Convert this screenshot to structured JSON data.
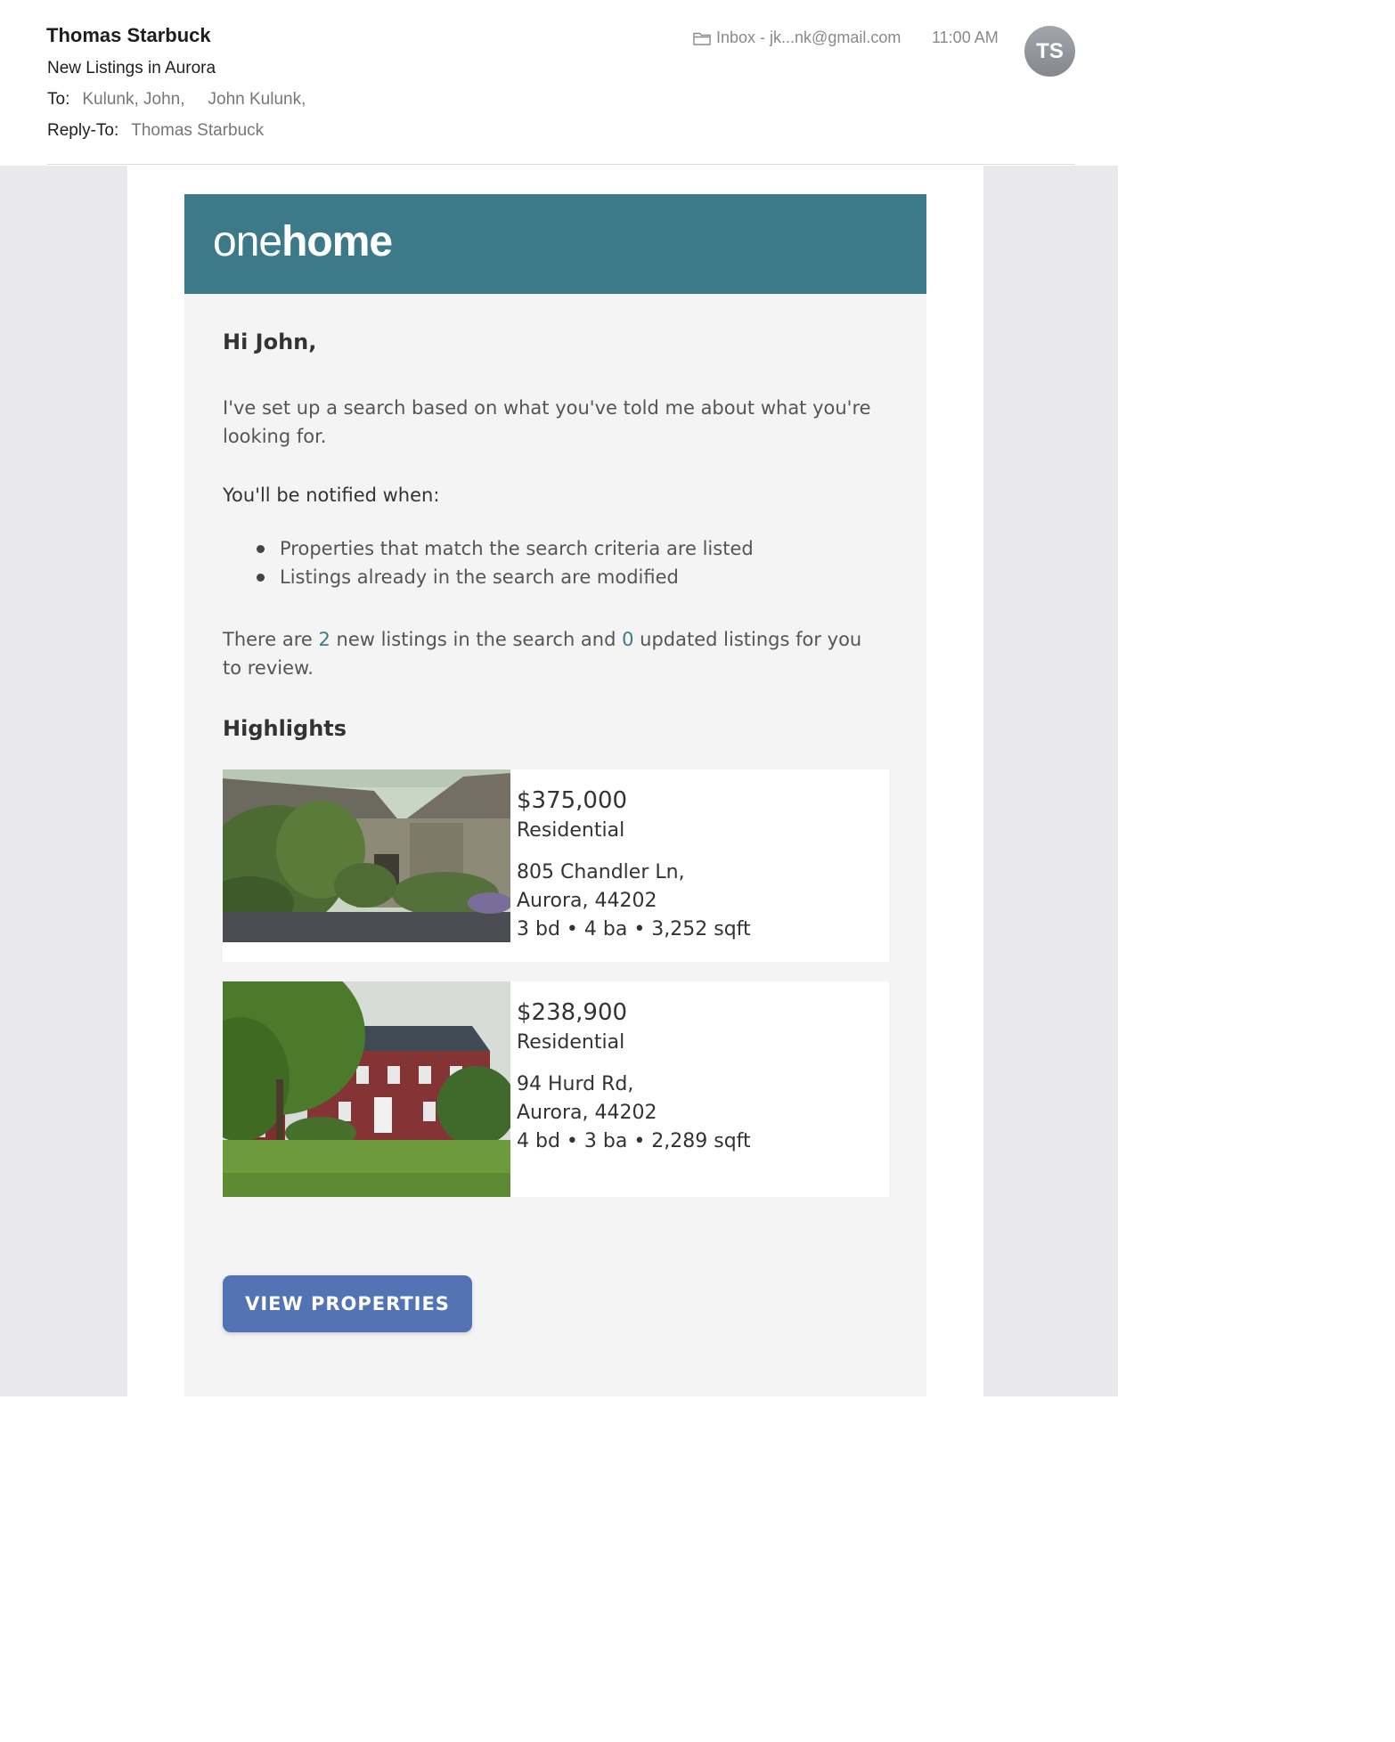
{
  "header": {
    "sender": "Thomas Starbuck",
    "subject": "New Listings in Aurora",
    "to_label": "To:",
    "to_value_1": "Kulunk, John,",
    "to_value_2": "John Kulunk,",
    "reply_to_label": "Reply-To:",
    "reply_to_value": "Thomas Starbuck",
    "mailbox": "Inbox - jk...nk@gmail.com",
    "mailbox_icon": "folder-icon",
    "time": "11:00 AM",
    "avatar_initials": "TS"
  },
  "brand": {
    "logo_part1": "one",
    "logo_part2": "home",
    "bar_color": "#3c7a89"
  },
  "email": {
    "greeting": "Hi John,",
    "intro": "I've set up a search based on what you've told me about what you're looking for.",
    "notify_heading": "You'll be notified when:",
    "bullets": [
      "Properties that match the search criteria are listed",
      "Listings already in the search are modified"
    ],
    "summary_prefix": "There are ",
    "new_count": "2",
    "summary_middle": " new listings in the search and ",
    "updated_count": "0",
    "summary_suffix": " updated listings for you to review.",
    "highlights_heading": "Highlights",
    "listings": [
      {
        "price": "$375,000",
        "type": "Residential",
        "address_line1": "805 Chandler Ln,",
        "address_line2": "Aurora, 44202",
        "facts": "3 bd • 4 ba • 3,252 sqft"
      },
      {
        "price": "$238,900",
        "type": "Residential",
        "address_line1": "94 Hurd Rd,",
        "address_line2": "Aurora, 44202",
        "facts": "4 bd • 3 ba • 2,289 sqft"
      }
    ],
    "button_label": "VIEW PROPERTIES",
    "button_color": "#5373b4"
  }
}
